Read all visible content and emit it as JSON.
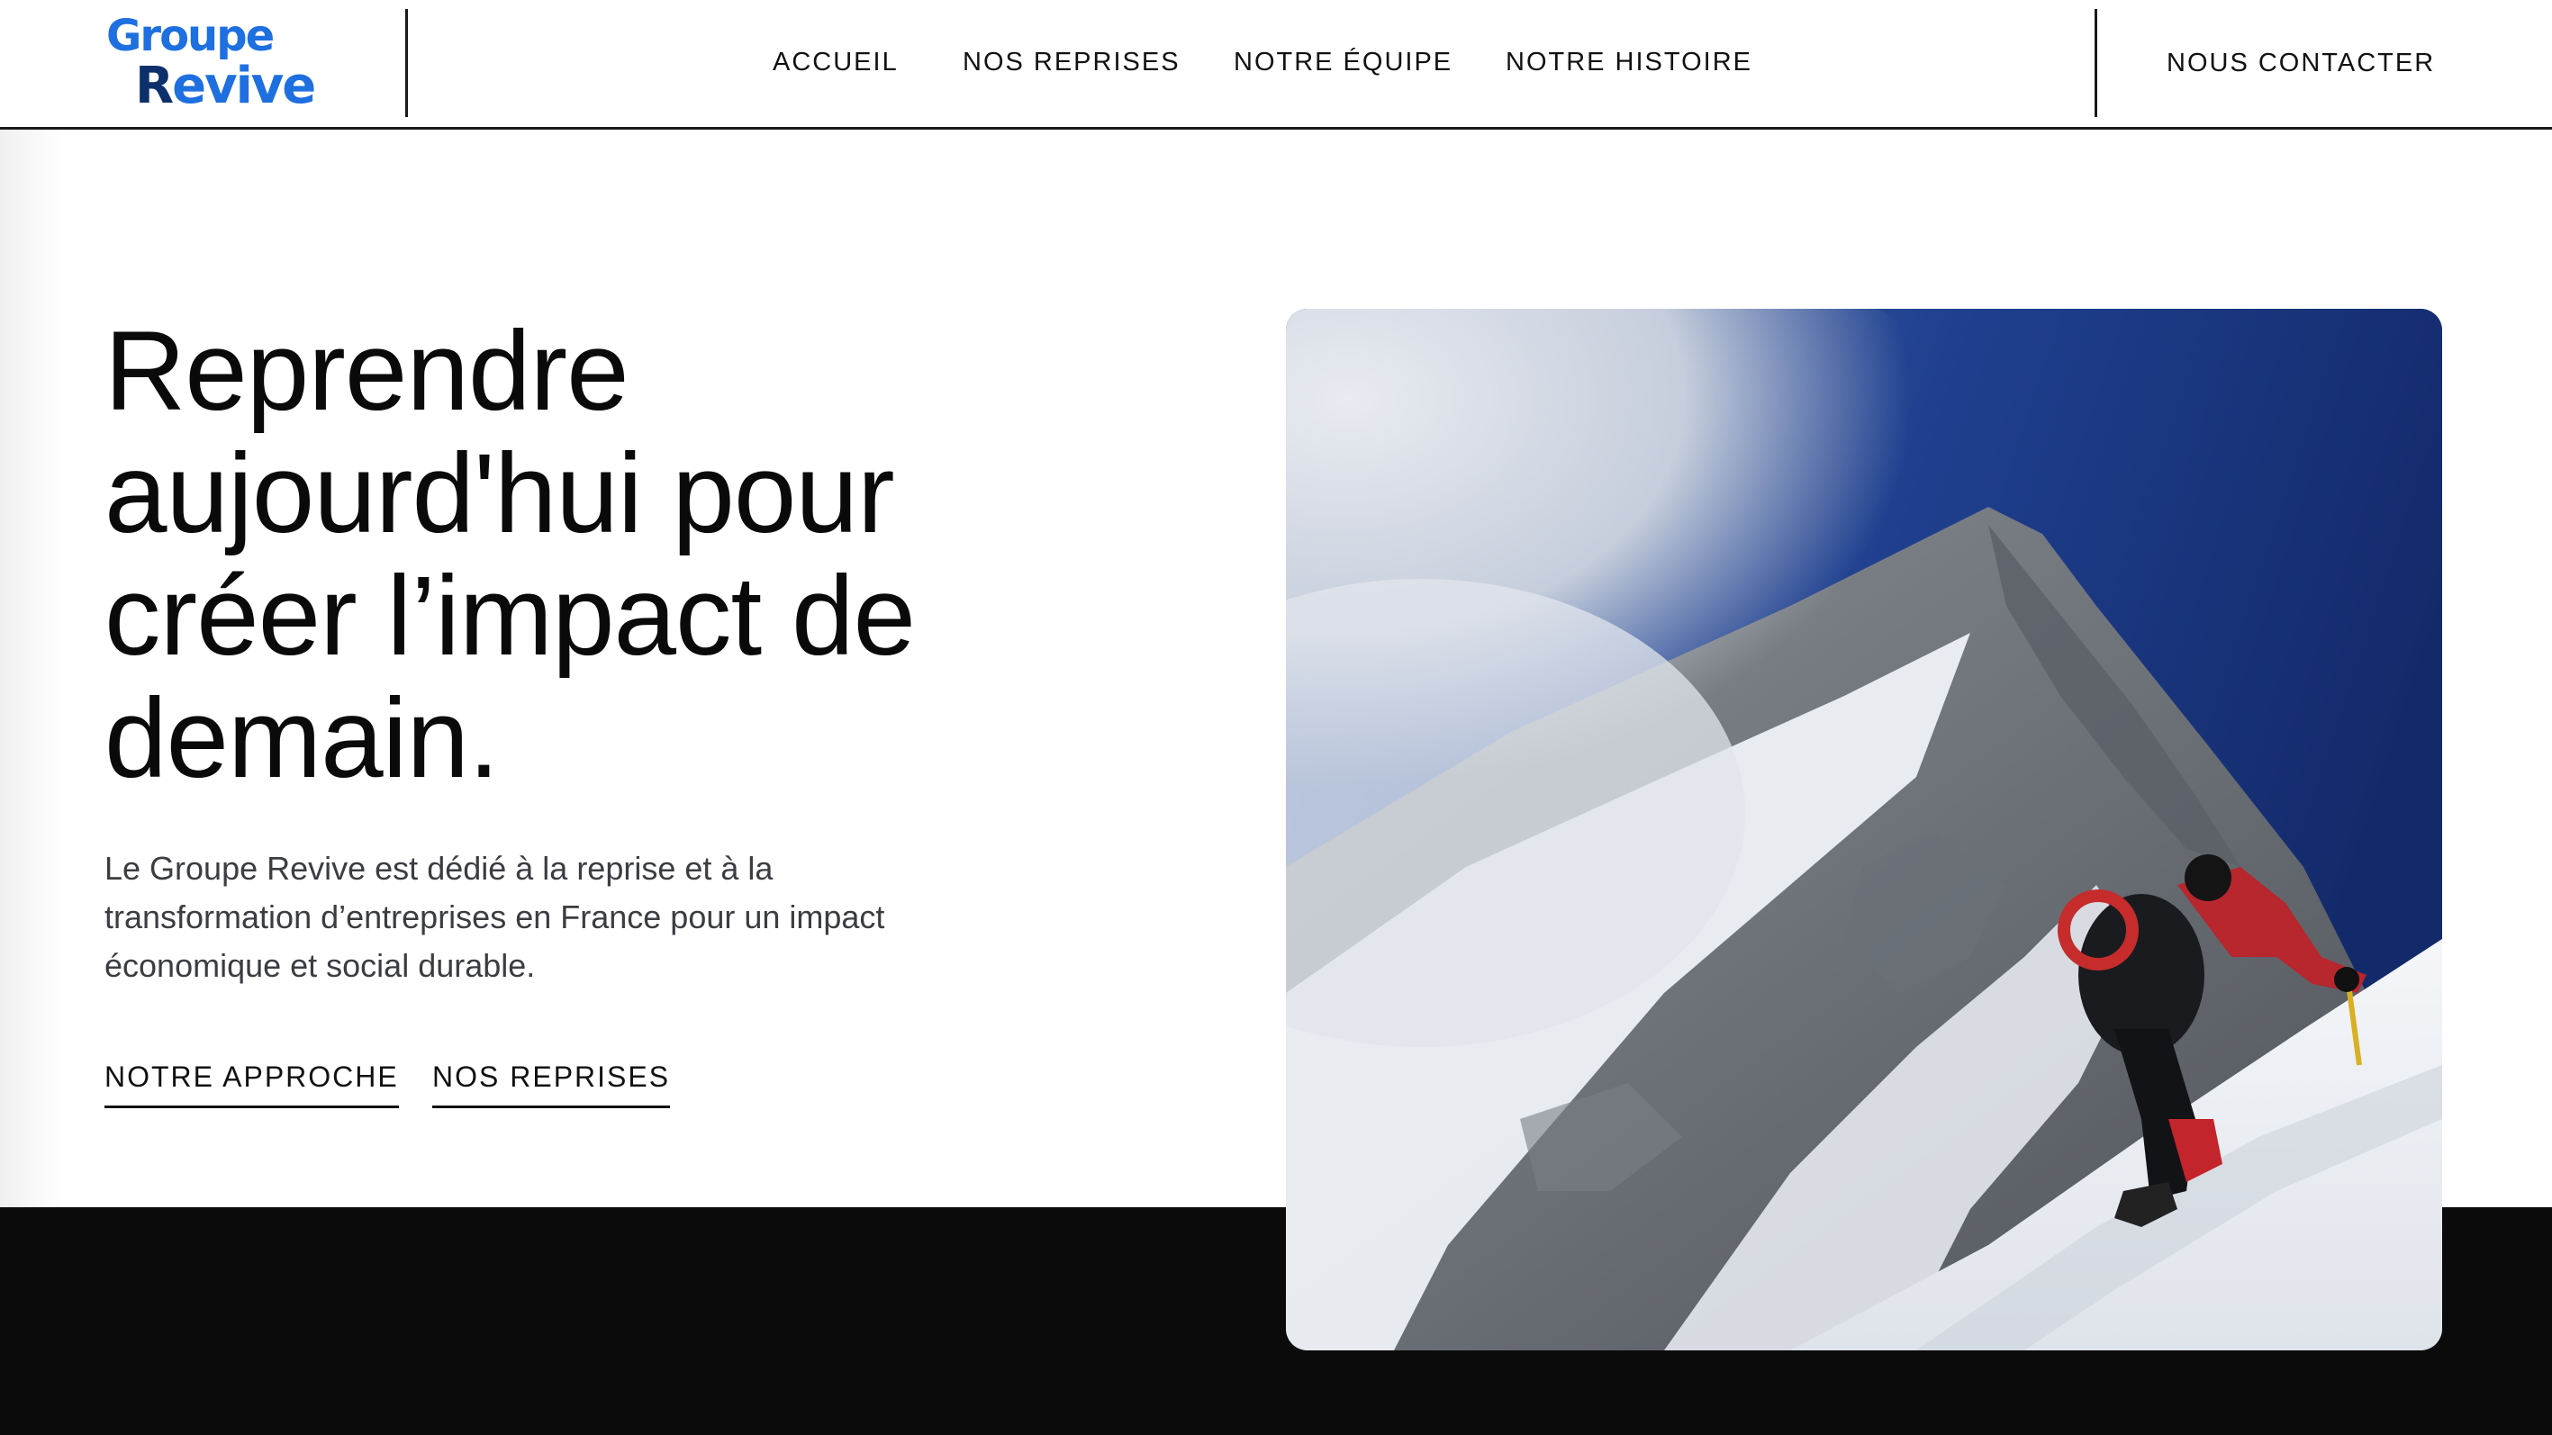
{
  "brand": {
    "line1": "Groupe",
    "line2_first": "R",
    "line2_rest": "evive",
    "color": "#1e6fe0",
    "accent_color": "#0d2f6b"
  },
  "nav": {
    "items": [
      {
        "label": "ACCUEIL"
      },
      {
        "label": "NOS REPRISES"
      },
      {
        "label": "NOTRE ÉQUIPE"
      },
      {
        "label": "NOTRE HISTOIRE"
      }
    ],
    "contact_label": "NOUS CONTACTER"
  },
  "hero": {
    "title_lines": [
      "Reprendre",
      "aujourd'hui pour",
      "créer l’impact de",
      "demain."
    ],
    "description": "Le Groupe Revive est dédié à la reprise et à la transformation d’entreprises en France pour un impact économique et social durable.",
    "cta": [
      {
        "label": "NOTRE APPROCHE"
      },
      {
        "label": "NOS REPRISES"
      }
    ]
  },
  "colors": {
    "dark_band": "#0b0b0c",
    "text": "#0a0a0b",
    "muted_text": "#3b3d42",
    "sky": "#1f3f8e"
  }
}
